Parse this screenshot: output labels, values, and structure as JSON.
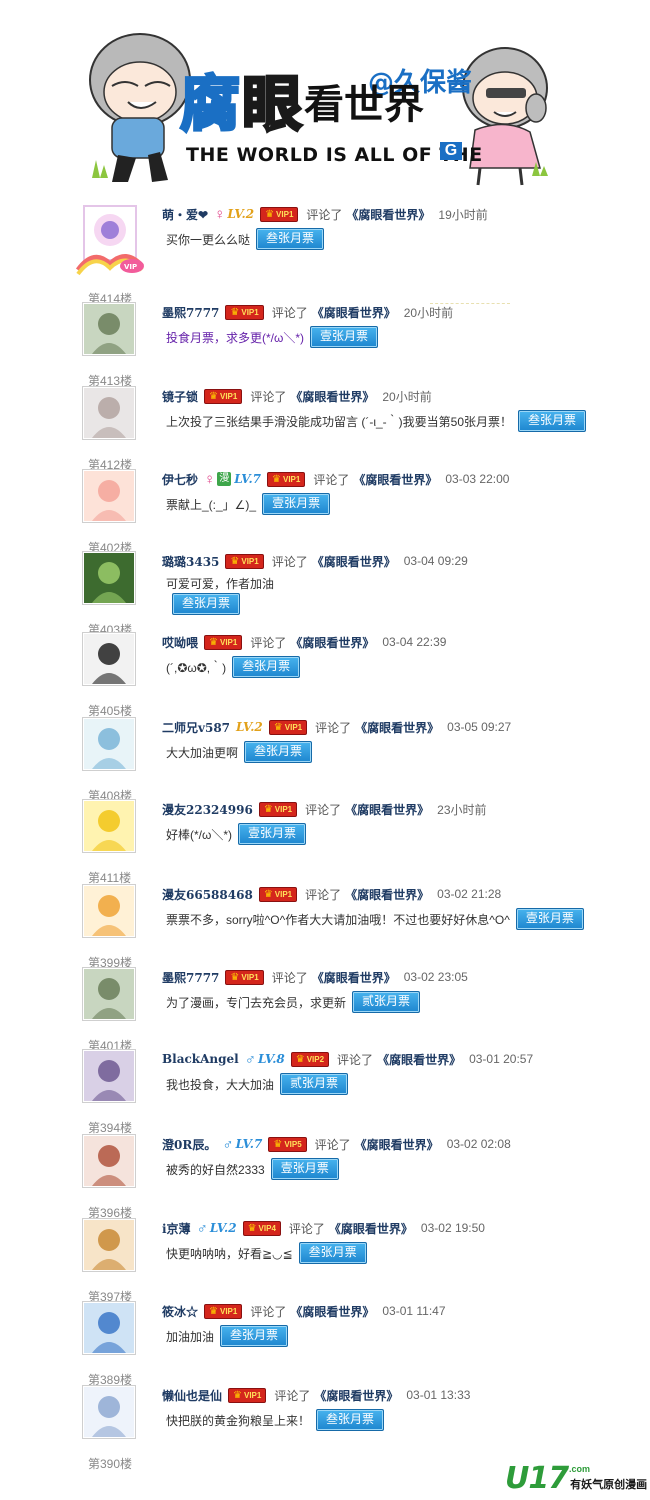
{
  "banner": {
    "title_chars": [
      "腐",
      "眼",
      "看世界"
    ],
    "author": "@久保酱",
    "subtitle": "THE WORLD IS ALL OF THE",
    "subtitle_badge": "G"
  },
  "work_title": "《腐眼看世界》",
  "action_text": "评论了",
  "comments": [
    {
      "user": "萌・爱❤",
      "gender": "♀",
      "level": "LV.2",
      "vip": "VIP1",
      "time": "19小时前",
      "message": "买你一更么么哒",
      "ticket": "叁张月票",
      "floor": "第414楼"
    },
    {
      "user": "墨熙7777",
      "vip": "VIP1",
      "time": "20小时前",
      "message": "投食月票，求多更(*/ω＼*)",
      "ticket": "壹张月票",
      "floor": "第413楼"
    },
    {
      "user": "镜子锁",
      "vip": "VIP1",
      "time": "20小时前",
      "message": "上次投了三张结果手滑没能成功留言 (´-ι_-｀)我要当第50张月票！",
      "ticket": "叁张月票",
      "floor": "第412楼"
    },
    {
      "user": "伊七秒",
      "gender": "♀",
      "level": "LV.7",
      "vip": "VIP1",
      "time": "03-03 22:00",
      "message": "票献上_(:_」∠)_",
      "ticket": "壹张月票",
      "floor": "第402楼",
      "man_icon": "漫"
    },
    {
      "user": "璐璐3435",
      "vip": "VIP1",
      "time": "03-04 09:29",
      "message": "可爱可爱，作者加油",
      "ticket": "叁张月票",
      "floor": "第403楼"
    },
    {
      "user": "哎呦喂",
      "vip": "VIP1",
      "time": "03-04 22:39",
      "message": "(´,✪ω✪,｀)",
      "ticket": "叁张月票",
      "floor": "第405楼"
    },
    {
      "user": "二师兄v587",
      "level": "LV.2",
      "vip": "VIP1",
      "time": "03-05 09:27",
      "message": "大大加油更啊",
      "ticket": "叁张月票",
      "floor": "第408楼"
    },
    {
      "user": "漫友22324996",
      "vip": "VIP1",
      "time": "23小时前",
      "message": "好棒(*/ω＼*)",
      "ticket": "壹张月票",
      "floor": "第411楼"
    },
    {
      "user": "漫友66588468",
      "vip": "VIP1",
      "time": "03-02 21:28",
      "message": "票票不多，sorry啦^O^作者大大请加油哦！不过也要好好休息^O^",
      "ticket": "壹张月票",
      "floor": "第399楼"
    },
    {
      "user": "墨熙7777",
      "vip": "VIP1",
      "time": "03-02 23:05",
      "message": "为了漫画，专门去充会员，求更新",
      "ticket": "贰张月票",
      "floor": "第401楼"
    },
    {
      "user": "BlackAngel",
      "gender": "♂",
      "level": "LV.8",
      "vip": "VIP2",
      "time": "03-01 20:57",
      "message": "我也投食，大大加油",
      "ticket": "贰张月票",
      "floor": "第394楼"
    },
    {
      "user": "澄0R辰。",
      "gender": "♂",
      "level": "LV.7",
      "vip": "VIP5",
      "time": "03-02 02:08",
      "message": "被秀的好自然2333",
      "ticket": "壹张月票",
      "floor": "第396楼"
    },
    {
      "user": "i京薄",
      "gender": "♂",
      "level": "LV.2",
      "vip": "VIP4",
      "time": "03-02 19:50",
      "message": "快更呐呐呐，好看≧◡≦",
      "ticket": "叁张月票",
      "floor": "第397楼"
    },
    {
      "user": "筱冰☆",
      "vip": "VIP1",
      "time": "03-01 11:47",
      "message": "加油加油",
      "ticket": "叁张月票",
      "floor": "第389楼"
    },
    {
      "user": "懒仙也是仙",
      "vip": "VIP1",
      "time": "03-01 13:33",
      "message": "快把朕的黄金狗粮呈上来！",
      "ticket": "叁张月票",
      "floor": "第390楼"
    }
  ],
  "footer": {
    "logo": "U17",
    "logo_suffix": ".com",
    "slogan": "有妖气原创漫画"
  },
  "colors": {
    "ticket_blue": "#2a95db",
    "vip_red": "#d4261c",
    "username": "#1f3b63",
    "accent_blue": "#1a6fc4"
  }
}
